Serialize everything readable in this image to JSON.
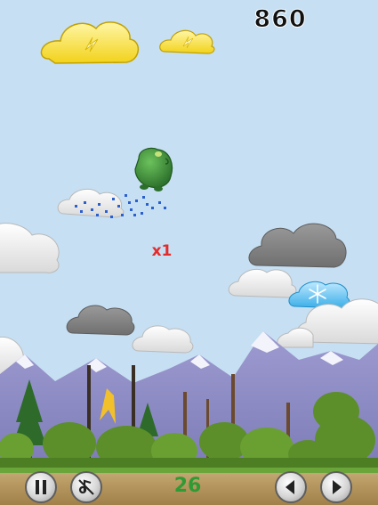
{
  "hud": {
    "score": "860",
    "multiplier": "x1",
    "counter": "26"
  },
  "icons": {
    "pause": "pause-icon",
    "sound": "music-note-muted-icon",
    "left": "arrow-left-icon",
    "right": "arrow-right-icon",
    "lightning_cloud": "lightning-icon",
    "snow_cloud": "snowflake-icon"
  },
  "colors": {
    "sky": "#c6dff3",
    "score": "#111111",
    "multiplier": "#e42b2b",
    "counter": "#2f9b34",
    "player": "#3d8a3a",
    "sparkle": "#2a5fd0"
  }
}
